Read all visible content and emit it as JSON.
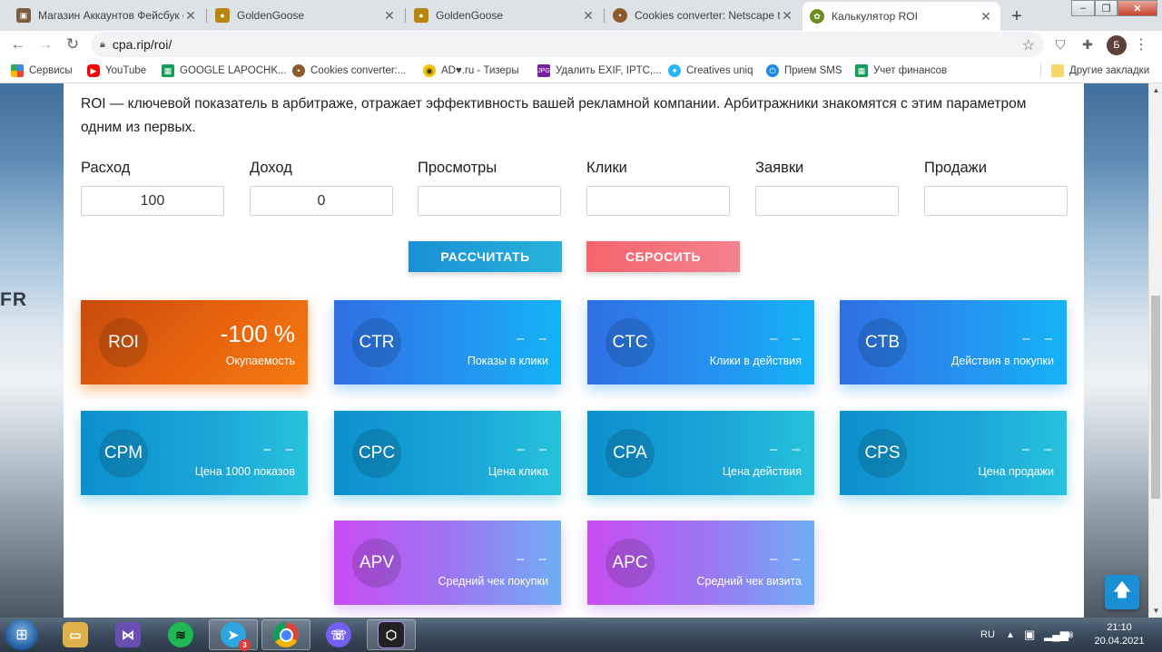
{
  "browser": {
    "tabs": [
      {
        "title": "Магазин Аккаунтов Фейсбук с",
        "icon": "store-favicon-icon",
        "color": "#7a5c3e"
      },
      {
        "title": "GoldenGoose",
        "icon": "goose-favicon-icon",
        "color": "#b8860b"
      },
      {
        "title": "GoldenGoose",
        "icon": "goose-favicon-icon",
        "color": "#b8860b"
      },
      {
        "title": "Cookies converter: Netscape to",
        "icon": "cookie-favicon-icon",
        "color": "#8d5a2b"
      },
      {
        "title": "Калькулятор ROI",
        "icon": "calculator-favicon-icon",
        "color": "#6b8e23"
      }
    ],
    "url": "cpa.rip/roi/",
    "profile_initial": "Б",
    "bookmarks": [
      {
        "label": "Сервисы",
        "icon": "apps-grid-icon"
      },
      {
        "label": "YouTube",
        "icon": "youtube-icon"
      },
      {
        "label": "GOOGLE LAPOCHK...",
        "icon": "sheets-icon"
      },
      {
        "label": "Cookies converter:...",
        "icon": "cookie-icon"
      },
      {
        "label": "AD♥.ru - Тизеры",
        "icon": "ad-icon"
      },
      {
        "label": "Удалить EXIF, IPTC,...",
        "icon": "jpg-icon"
      },
      {
        "label": "Creatives uniq",
        "icon": "creatives-icon"
      },
      {
        "label": "Прием SMS",
        "icon": "power-icon"
      },
      {
        "label": "Учет финансов",
        "icon": "sheets-icon"
      }
    ],
    "other_bookmarks": "Другие закладки"
  },
  "page": {
    "side_text": "FR",
    "description": "ROI — ключевой показатель в арбитраже, отражает эффективность вашей рекламной компании. Арбитражники знакомятся с этим параметром одним из первых.",
    "fields": [
      {
        "label": "Расход",
        "value": "100"
      },
      {
        "label": "Доход",
        "value": "0"
      },
      {
        "label": "Просмотры",
        "value": ""
      },
      {
        "label": "Клики",
        "value": ""
      },
      {
        "label": "Заявки",
        "value": ""
      },
      {
        "label": "Продажи",
        "value": ""
      }
    ],
    "calc_button": "РАССЧИТАТЬ",
    "reset_button": "СБРОСИТЬ",
    "cards": [
      {
        "code": "ROI",
        "value": "-100 %",
        "desc": "Окупаемость",
        "style": "orange"
      },
      {
        "code": "CTR",
        "value": "– –",
        "desc": "Показы в клики",
        "style": "blue"
      },
      {
        "code": "CTC",
        "value": "– –",
        "desc": "Клики в действия",
        "style": "blue"
      },
      {
        "code": "CTB",
        "value": "– –",
        "desc": "Действия в покупки",
        "style": "blue"
      },
      {
        "code": "CPM",
        "value": "– –",
        "desc": "Цена 1000 показов",
        "style": "cyan"
      },
      {
        "code": "CPC",
        "value": "– –",
        "desc": "Цена клика",
        "style": "cyan"
      },
      {
        "code": "CPA",
        "value": "– –",
        "desc": "Цена действия",
        "style": "cyan"
      },
      {
        "code": "CPS",
        "value": "– –",
        "desc": "Цена продажи",
        "style": "cyan"
      },
      {
        "code": "APV",
        "value": "– –",
        "desc": "Средний чек покупки",
        "style": "purple"
      },
      {
        "code": "APC",
        "value": "– –",
        "desc": "Средний чек визита",
        "style": "purple"
      }
    ]
  },
  "taskbar": {
    "apps": [
      {
        "name": "file-explorer-icon",
        "color": "#e0b14a"
      },
      {
        "name": "visual-studio-icon",
        "color": "#6a4fb3"
      },
      {
        "name": "spotify-icon",
        "color": "#1db954"
      },
      {
        "name": "telegram-icon",
        "color": "#2ca5e0",
        "badge": "3"
      },
      {
        "name": "chrome-icon",
        "color": "#db4437"
      },
      {
        "name": "viber-icon",
        "color": "#7360f2"
      },
      {
        "name": "app-hex-icon",
        "color": "#222222"
      }
    ],
    "lang": "RU",
    "time": "21:10",
    "date": "20.04.2021"
  }
}
